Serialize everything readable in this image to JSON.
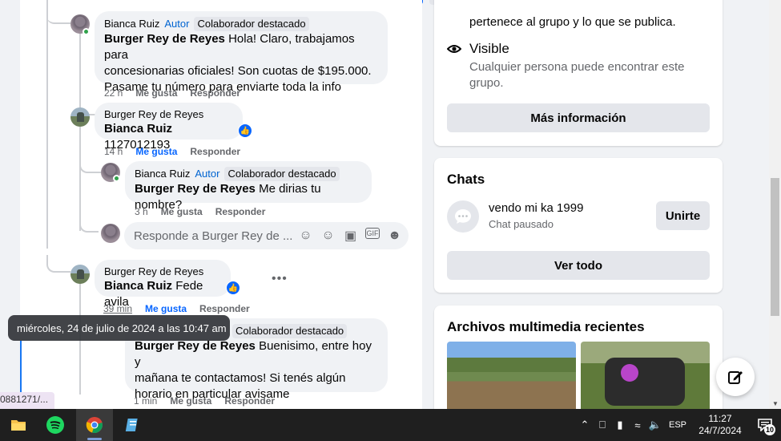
{
  "top": {},
  "comments": [
    {
      "author": "Bianca Ruiz",
      "badge_autor": "Autor",
      "badge_colab": "Colaborador destacado",
      "mention": "Burger Rey de Reyes",
      "line1": " Hola! Claro, trabajamos para",
      "line2": "concesionarias oficiales! Son cuotas de $195.000.",
      "line3": "Pasame tu número para enviarte toda la info",
      "time": "22 h",
      "like": "Me gusta",
      "reply": "Responder"
    },
    {
      "author": "Burger Rey de Reyes",
      "mention": "Bianca Ruiz",
      "text": " 1127012193",
      "time": "14 h",
      "like": "Me gusta",
      "reply": "Responder"
    },
    {
      "author": "Bianca Ruiz",
      "badge_autor": "Autor",
      "badge_colab": "Colaborador destacado",
      "mention": "Burger Rey de Reyes",
      "text": " Me dirias tu nombre?",
      "time": "3 h",
      "like": "Me gusta",
      "reply": "Responder"
    },
    {
      "author": "Burger Rey de Reyes",
      "mention": "Bianca Ruiz",
      "text": " Fede avila",
      "time": "39 min",
      "like": "Me gusta",
      "reply": "Responder"
    },
    {
      "badge_colab": "Colaborador destacado",
      "mention": "Burger Rey de Reyes",
      "line1": " Buenisimo, entre hoy y",
      "line2": "mañana te contactamos! Si tenés algún",
      "line3": "horario en particular avisame",
      "time": "1 min",
      "like": "Me gusta",
      "reply": "Responder"
    }
  ],
  "reply_box": {
    "placeholder": "Responde a Burger Rey de ..."
  },
  "tooltip": "miércoles, 24 de julio de 2024 a las 10:47 am",
  "url_fragment": "0881271/...",
  "about": {
    "privacy_text": "pertenece al grupo y lo que se publica.",
    "visible_title": "Visible",
    "visible_line1": "Cualquier persona puede encontrar este",
    "visible_line2": "grupo.",
    "more_info_button": "Más información"
  },
  "chats": {
    "title": "Chats",
    "chat_name": "vendo mi ka 1999",
    "chat_status": "Chat pausado",
    "join_button": "Unirte",
    "see_all_button": "Ver todo"
  },
  "media": {
    "title": "Archivos multimedia recientes"
  },
  "taskbar": {
    "language": "ESP",
    "time": "11:27",
    "date": "24/7/2024",
    "notification_count": "10"
  },
  "colors": {
    "facebook_blue": "#0866ff",
    "link_blue": "#0064d1",
    "online_green": "#31a24c"
  }
}
